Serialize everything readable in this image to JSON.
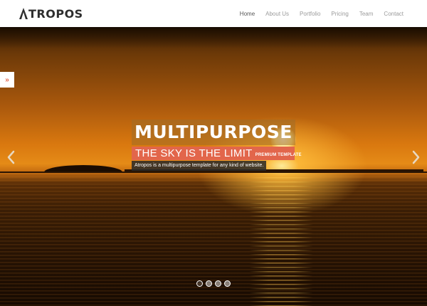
{
  "brand": {
    "name": "TROPOS",
    "mark": "A"
  },
  "nav": {
    "items": [
      {
        "label": "Home",
        "active": true
      },
      {
        "label": "About Us",
        "active": false
      },
      {
        "label": "Portfolio",
        "active": false
      },
      {
        "label": "Pricing",
        "active": false
      },
      {
        "label": "Team",
        "active": false
      },
      {
        "label": "Contact",
        "active": false
      }
    ]
  },
  "side_tab": {
    "icon": "double-chevron-right-icon",
    "glyph": "»"
  },
  "slider": {
    "title": "MULTIPURPOSE",
    "subtitle": "THE SKY IS THE LIMIT",
    "tag": "PREMIUM TEMPLATE",
    "description": "Atropos is a multipurpose template for any kind of website.",
    "prev_icon": "chevron-left-icon",
    "next_icon": "chevron-right-icon",
    "slides_count": 4,
    "active_slide": 1
  },
  "colors": {
    "accent": "#e2664b",
    "header_bg": "#ffffff",
    "nav_text": "#9a9a9a"
  }
}
